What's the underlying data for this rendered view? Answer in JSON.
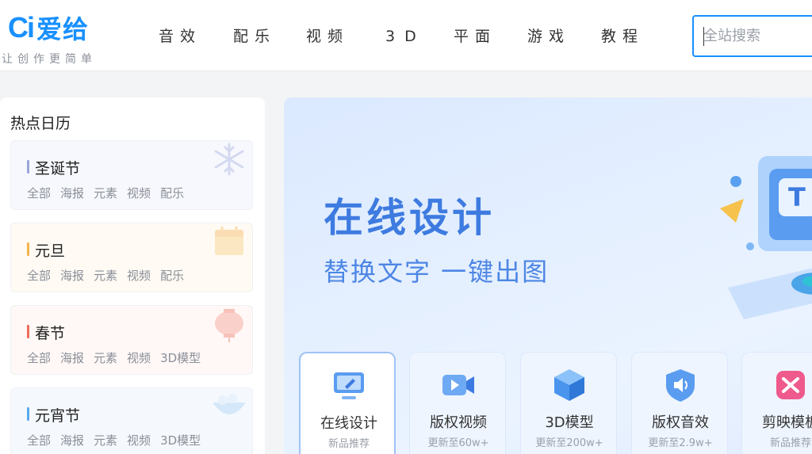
{
  "header": {
    "logo_mark": "Ci",
    "logo_text": "爱给",
    "slogan": "让创作更简单",
    "nav": [
      "音效",
      "配乐",
      "视频",
      "3D",
      "平面",
      "游戏",
      "教程"
    ],
    "search_placeholder": "全站搜索"
  },
  "calendar": {
    "title": "热点日历",
    "cards": [
      {
        "name": "圣诞节",
        "bar_color": "#9aa6d8",
        "deco_icon": "snowflake-icon",
        "tags": [
          "全部",
          "海报",
          "元素",
          "视频",
          "配乐"
        ]
      },
      {
        "name": "元旦",
        "bar_color": "#f6b44b",
        "deco_icon": "calendar-icon",
        "tags": [
          "全部",
          "海报",
          "元素",
          "视频",
          "配乐"
        ]
      },
      {
        "name": "春节",
        "bar_color": "#ef6b5a",
        "deco_icon": "lantern-icon",
        "tags": [
          "全部",
          "海报",
          "元素",
          "视频",
          "3D模型"
        ]
      },
      {
        "name": "元宵节",
        "bar_color": "#5aa9ef",
        "deco_icon": "bowl-icon",
        "tags": [
          "全部",
          "海报",
          "元素",
          "视频",
          "3D模型"
        ]
      }
    ]
  },
  "banner": {
    "title": "在线设计",
    "subtitle": "替换文字 一键出图",
    "features": [
      {
        "name": "在线设计",
        "sub": "新品推荐",
        "icon": "monitor-pen-icon"
      },
      {
        "name": "版权视频",
        "sub": "更新至60w+",
        "icon": "video-camera-icon"
      },
      {
        "name": "3D模型",
        "sub": "更新至200w+",
        "icon": "cube-icon"
      },
      {
        "name": "版权音效",
        "sub": "更新至2.9w+",
        "icon": "sound-shield-icon"
      },
      {
        "name": "剪映模板",
        "sub": "新品推荐",
        "icon": "capcut-icon"
      }
    ]
  },
  "colors": {
    "brand": "#1890ff",
    "banner_title": "#3e7be0"
  }
}
